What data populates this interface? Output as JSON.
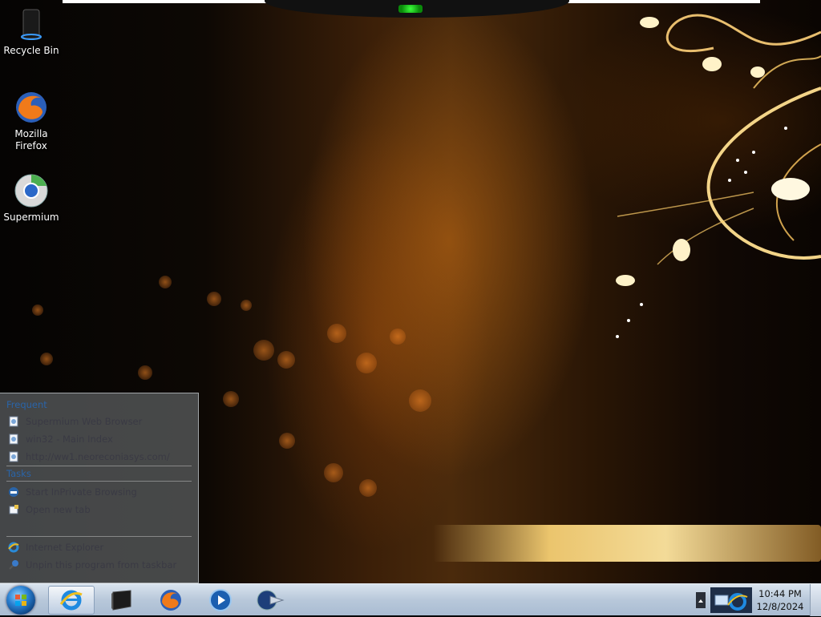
{
  "desktop": {
    "icons": [
      {
        "label": "Recycle Bin",
        "icon": "recycle-bin-icon"
      },
      {
        "label": "Mozilla Firefox",
        "icon": "firefox-icon"
      },
      {
        "label": "Supermium",
        "icon": "supermium-icon"
      }
    ]
  },
  "jumplist": {
    "frequent_header": "Frequent",
    "frequent": [
      {
        "label": "Supermium Web Browser",
        "icon": "page-icon"
      },
      {
        "label": "win32 - Main Index",
        "icon": "page-icon"
      },
      {
        "label": "http://ww1.neoreconiasys.com/",
        "icon": "page-icon"
      }
    ],
    "tasks_header": "Tasks",
    "tasks": [
      {
        "label": "Start InPrivate Browsing",
        "icon": "inprivate-icon"
      },
      {
        "label": "Open new tab",
        "icon": "new-tab-icon"
      }
    ],
    "program": [
      {
        "label": "Internet Explorer",
        "icon": "internet-explorer-icon"
      },
      {
        "label": "Unpin this program from taskbar",
        "icon": "unpin-icon"
      }
    ]
  },
  "taskbar": {
    "items": [
      {
        "name": "internet-explorer",
        "icon": "internet-explorer-icon",
        "active": true
      },
      {
        "name": "terminal",
        "icon": "terminal-icon",
        "active": false
      },
      {
        "name": "firefox",
        "icon": "firefox-icon",
        "active": false
      },
      {
        "name": "media-player",
        "icon": "media-player-icon",
        "active": false
      },
      {
        "name": "supermium",
        "icon": "supermium-icon",
        "active": false
      }
    ],
    "clock": {
      "time": "10:44 PM",
      "date": "12/8/2024"
    }
  }
}
